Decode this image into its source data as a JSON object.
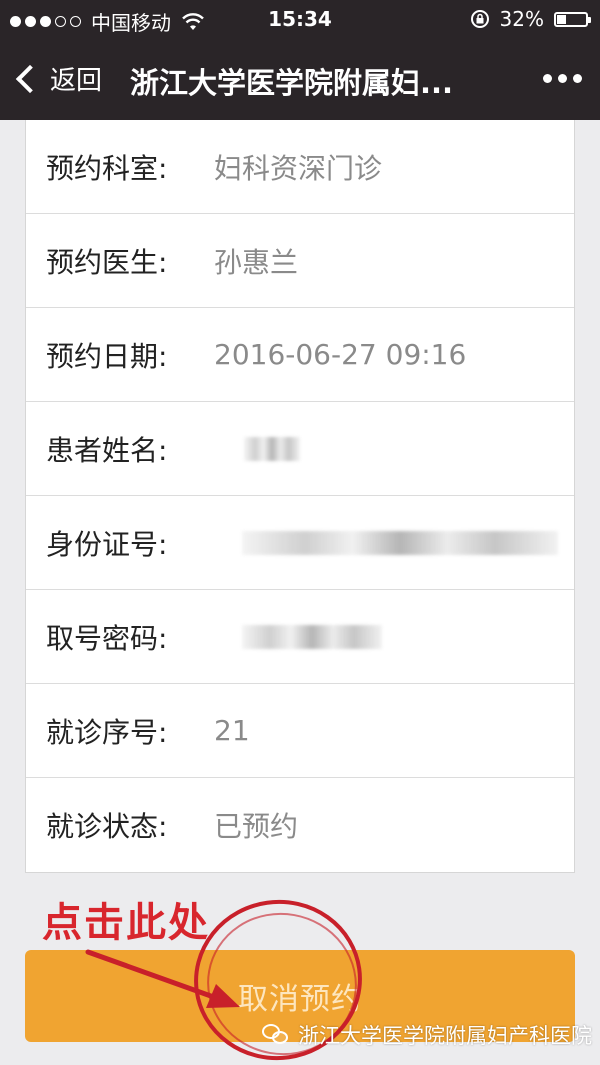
{
  "status_bar": {
    "carrier": "中国移动",
    "time": "15:34",
    "battery": "32%",
    "battery_level": 0.32
  },
  "nav": {
    "back_label": "返回",
    "title": "浙江大学医学院附属妇..."
  },
  "rows": [
    {
      "label": "预约科室:",
      "value": "妇科资深门诊"
    },
    {
      "label": "预约医生:",
      "value": "孙惠兰"
    },
    {
      "label": "预约日期:",
      "value": "2016-06-27 09:16"
    },
    {
      "label": "患者姓名:",
      "value": ""
    },
    {
      "label": "身份证号:",
      "value": ""
    },
    {
      "label": "取号密码:",
      "value": ""
    },
    {
      "label": "就诊序号:",
      "value": "21"
    },
    {
      "label": "就诊状态:",
      "value": "已预约"
    }
  ],
  "cancel_button_label": "取消预约",
  "annotation": {
    "text": "点击此处",
    "color": "#d8262d"
  },
  "watermark": "浙江大学医学院附属妇产科医院",
  "colors": {
    "nav_bg": "#2a2528",
    "button_bg": "#f0a431",
    "page_bg": "#ececee"
  }
}
